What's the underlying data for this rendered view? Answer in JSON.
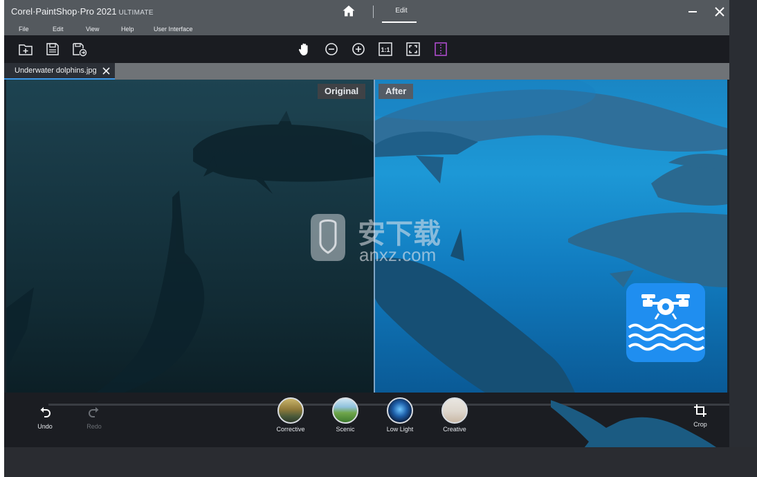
{
  "window": {
    "brand": "Corel·PaintShop·Pro 2021",
    "edition": "ULTIMATE",
    "mode_tab": "Edit"
  },
  "menu": [
    "File",
    "Edit",
    "View",
    "Help",
    "User Interface"
  ],
  "toolbar": {
    "left_icons": [
      "new-file-icon",
      "save-icon",
      "save-as-icon"
    ],
    "right_icons": [
      "pan-hand-icon",
      "zoom-out-icon",
      "zoom-in-icon",
      "actual-size-icon",
      "fit-to-window-icon",
      "split-view-icon"
    ],
    "actual_size_text": "1:1"
  },
  "document": {
    "tab_label": "Underwater dolphins.jpg"
  },
  "compare": {
    "original_label": "Original",
    "after_label": "After"
  },
  "bottom": {
    "undo_label": "Undo",
    "redo_label": "Redo",
    "crop_label": "Crop",
    "presets": [
      {
        "label": "Corrective",
        "icon": "landscape-thumb"
      },
      {
        "label": "Scenic",
        "icon": "scenic-thumb"
      },
      {
        "label": "Low Light",
        "icon": "low-light-thumb"
      },
      {
        "label": "Creative",
        "icon": "creative-thumb"
      }
    ]
  },
  "colors": {
    "titlebar": "#54595e",
    "toolbar": "#1a1c21",
    "accent": "#3d98e8",
    "split_view_accent": "#b84fd8",
    "underwater_badge": "#1f8ef0"
  },
  "overlay": {
    "watermark_text": "安下载",
    "watermark_url": "anxz.com",
    "badge_icon": "underwater-drone-icon"
  }
}
